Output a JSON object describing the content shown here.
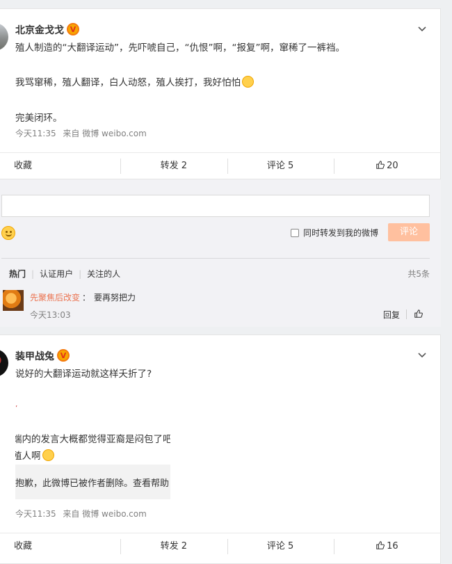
{
  "post1": {
    "username": "北京金戈戈",
    "verified_badge": "V",
    "lines": [
      "殖人制造的“大翻译运动”，先吓唬自己，“仇恨”啊，“报复”啊，窜稀了一裤裆。",
      "我骂窜稀，殖人翻译，白人动怒，殖人挨打，我好怕怕",
      "完美闭环。"
    ],
    "time": "今天11:35",
    "source": "来自 微博 weibo.com",
    "actions": {
      "favorite": "收藏",
      "repost": "转发 2",
      "comment": "评论 5",
      "like": "20"
    }
  },
  "comment_area": {
    "repost_checkbox_label": "同时转发到我的微博",
    "submit_label": "评论",
    "tabs": [
      "热门",
      "认证用户",
      "关注的人"
    ],
    "total": "共5条",
    "comment": {
      "user": "先聚焦后改变",
      "colon": "：",
      "text": "要再努把力",
      "time": "今天13:03",
      "reply": "回复"
    }
  },
  "post2": {
    "username": "装甲战兔",
    "verified_badge": "V",
    "text": "说好的大翻译运动就这样夭折了?",
    "crop_line1": "端内的发言大概都觉得亚裔是闷包了吧,",
    "crop_line2": "殖人啊",
    "deleted_notice": "抱歉，此微博已被作者删除。查看帮助",
    "time": "今天11:35",
    "source": "来自 微博 weibo.com",
    "actions": {
      "favorite": "收藏",
      "repost": "转发 2",
      "comment": "评论 5",
      "like": "16"
    }
  },
  "colors": {
    "accent": "#eb7350",
    "submit_disabled": "#ffc09f",
    "badge": "#f7a600"
  }
}
